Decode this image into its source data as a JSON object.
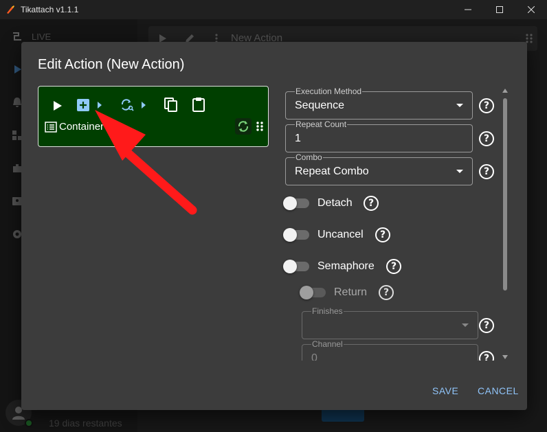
{
  "window": {
    "title": "Tikattach v1.1.1"
  },
  "background": {
    "live_label": "LIVE",
    "action_title": "New Action",
    "days_remaining": "19 dias restantes"
  },
  "dialog": {
    "title": "Edit Action (New Action)",
    "container_label": "Container",
    "fields": {
      "execution_method": {
        "label": "Execution Method",
        "value": "Sequence"
      },
      "repeat_count": {
        "label": "Repeat Count",
        "value": "1"
      },
      "combo": {
        "label": "Combo",
        "value": "Repeat Combo"
      },
      "finishes": {
        "label": "Finishes",
        "value": ""
      },
      "channel": {
        "label": "Channel",
        "value": "0"
      }
    },
    "toggles": {
      "detach": "Detach",
      "uncancel": "Uncancel",
      "semaphore": "Semaphore",
      "return": "Return"
    },
    "help_glyph": "?",
    "save": "SAVE",
    "cancel": "CANCEL"
  },
  "colors": {
    "container_bg": "#003f00",
    "accent_blue": "#90c4f9",
    "annotation_arrow": "#ff1a1a"
  }
}
